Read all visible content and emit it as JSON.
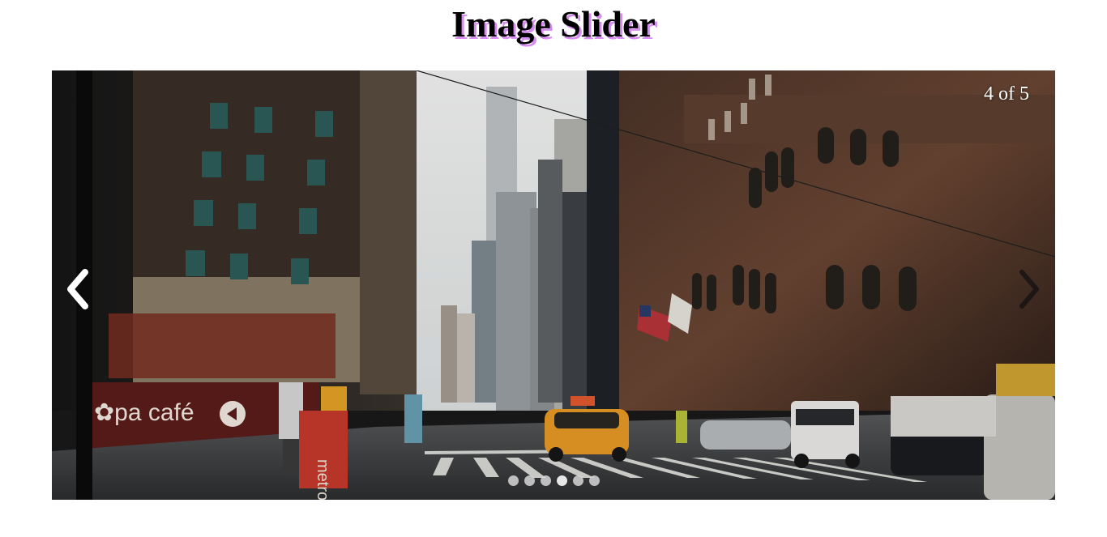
{
  "page": {
    "title": "Image Slider",
    "title_shadow_color": "#d68cf0"
  },
  "slider": {
    "counter_text": "4 of 5",
    "current_slide": 4,
    "total_slides": 5,
    "image_description_icon": "city-street-photo",
    "prev_icon": "chevron-left-icon",
    "next_icon": "chevron-right-icon",
    "dot_count": 6
  }
}
